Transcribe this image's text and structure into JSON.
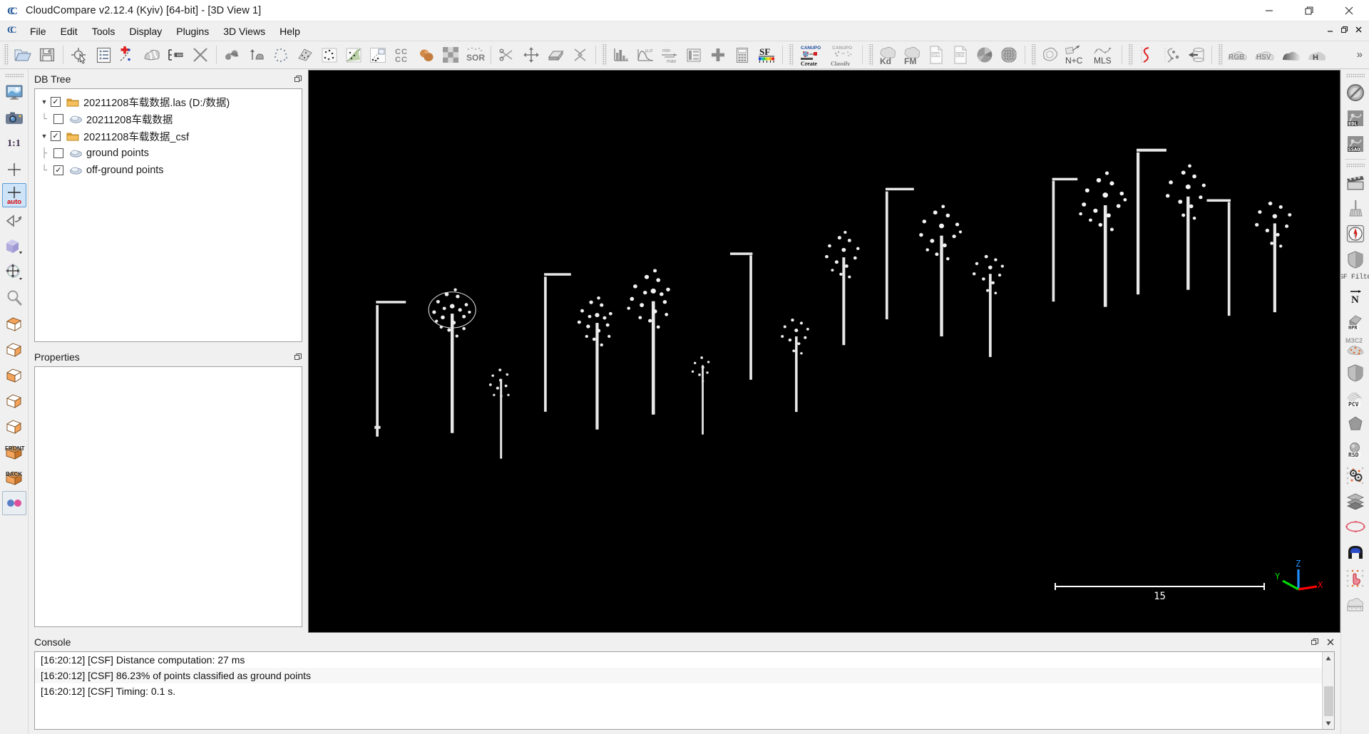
{
  "window": {
    "title": "CloudCompare v2.12.4 (Kyiv) [64-bit] - [3D View 1]",
    "app_icon": "C",
    "minimize": "—",
    "maximize": "❐",
    "close": "✕"
  },
  "menu": {
    "icon": "C",
    "items": [
      {
        "label": "File"
      },
      {
        "label": "Edit"
      },
      {
        "label": "Tools"
      },
      {
        "label": "Display"
      },
      {
        "label": "Plugins"
      },
      {
        "label": "3D Views"
      },
      {
        "label": "Help"
      }
    ],
    "mdi": {
      "minimize": "–",
      "restore": "❐",
      "close": "✕"
    }
  },
  "toolbar": {
    "overflow": "»",
    "groups": [
      {
        "buttons": [
          {
            "name": "open-file-icon",
            "label": ""
          },
          {
            "name": "save-file-icon",
            "label": ""
          }
        ]
      },
      {
        "buttons": [
          {
            "name": "select-entity-icon",
            "label": ""
          },
          {
            "name": "properties-list-icon",
            "label": ""
          },
          {
            "name": "add-point-pair-icon",
            "label": ""
          },
          {
            "name": "segment-cloud-icon",
            "label": ""
          },
          {
            "name": "translate-rotate-icon",
            "label": ""
          },
          {
            "name": "delete-icon",
            "label": ""
          }
        ]
      },
      {
        "buttons": [
          {
            "name": "clone-cloud-icon",
            "label": ""
          },
          {
            "name": "merge-clouds-icon",
            "label": ""
          },
          {
            "name": "subsample-icon",
            "label": ""
          },
          {
            "name": "fit-plane-icon",
            "label": ""
          },
          {
            "name": "registration-icon",
            "label": ""
          },
          {
            "name": "align-icon",
            "label": ""
          },
          {
            "name": "match-bbox-icon",
            "label": ""
          },
          {
            "name": "cloud-cloud-dist-icon",
            "label": "CC"
          },
          {
            "name": "cloud-mesh-dist-icon",
            "label": ""
          },
          {
            "name": "noise-filter-icon",
            "label": ""
          },
          {
            "name": "sor-filter-icon",
            "label": "SOR"
          }
        ]
      },
      {
        "buttons": [
          {
            "name": "scissors-cut-icon",
            "label": ""
          },
          {
            "name": "translate-axis-icon",
            "label": ""
          },
          {
            "name": "cross-section-icon",
            "label": ""
          },
          {
            "name": "unroll-icon",
            "label": ""
          }
        ]
      },
      {
        "buttons": [
          {
            "name": "histogram-icon",
            "label": ""
          },
          {
            "name": "gaussian-stats-icon",
            "label": "μ,σ"
          },
          {
            "name": "minmax-icon",
            "label": "min max"
          },
          {
            "name": "sf-gradient-icon",
            "label": ""
          },
          {
            "name": "sf-add-icon",
            "label": "+"
          },
          {
            "name": "sf-arithmetic-icon",
            "label": ""
          },
          {
            "name": "sf-colorscale-icon",
            "label": "SF"
          }
        ]
      },
      {
        "buttons": [
          {
            "name": "canupo-create-icon",
            "label": "CANUPO Create"
          },
          {
            "name": "canupo-classify-icon",
            "label": "CANUPO Classify"
          }
        ]
      },
      {
        "buttons": [
          {
            "name": "kdtree-icon",
            "label": "Kd"
          },
          {
            "name": "fastmarching-icon",
            "label": "FM"
          },
          {
            "name": "shp-export-icon",
            "label": "SHP"
          },
          {
            "name": "csv-export-icon",
            "label": "CSV"
          },
          {
            "name": "poisson-recon-icon",
            "label": ""
          },
          {
            "name": "qhull-sphere-icon",
            "label": ""
          }
        ]
      },
      {
        "buttons": [
          {
            "name": "contour-plugin-icon",
            "label": ""
          },
          {
            "name": "normal-curvature-icon",
            "label": "N+C"
          },
          {
            "name": "mls-smoothing-icon",
            "label": "MLS"
          }
        ]
      },
      {
        "buttons": [
          {
            "name": "spline-fit-icon",
            "label": ""
          },
          {
            "name": "ransac-shapes-icon",
            "label": ""
          },
          {
            "name": "cylinder-unroll-icon",
            "label": ""
          }
        ]
      },
      {
        "buttons": [
          {
            "name": "rgb-convert-icon",
            "label": "RGB"
          },
          {
            "name": "hsv-convert-icon",
            "label": "HSV"
          },
          {
            "name": "gradient-color-icon",
            "label": ""
          },
          {
            "name": "height-ramp-icon",
            "label": "H"
          }
        ]
      }
    ]
  },
  "left_toolbar": {
    "buttons": [
      {
        "name": "full-screen-view-icon",
        "label": "",
        "active": false
      },
      {
        "name": "snapshot-camera-icon",
        "label": "",
        "active": false
      },
      {
        "name": "zoom-one-to-one-icon",
        "label": "1:1",
        "active": false
      },
      {
        "name": "set-pivot-icon",
        "label": "+",
        "active": false
      },
      {
        "name": "auto-pivot-icon",
        "label": "auto",
        "active": true
      },
      {
        "name": "toggle-rotation-icon",
        "label": "",
        "active": false
      },
      {
        "name": "view-cube-dropdown-icon",
        "label": "",
        "active": false
      },
      {
        "name": "pivot-mode-dropdown-icon",
        "label": "",
        "active": false
      },
      {
        "name": "zoom-magnifier-icon",
        "label": "",
        "active": false
      },
      {
        "name": "view-top-icon",
        "label": "",
        "active": false
      },
      {
        "name": "view-bottom-icon",
        "label": "",
        "active": false
      },
      {
        "name": "view-left-icon",
        "label": "",
        "active": false
      },
      {
        "name": "view-right-icon",
        "label": "",
        "active": false
      },
      {
        "name": "view-front-cube-icon",
        "label": "",
        "active": false
      },
      {
        "name": "view-back-cube-icon",
        "label": "",
        "active": false
      },
      {
        "name": "view-front-label-icon",
        "label": "FRONT",
        "active": false
      },
      {
        "name": "view-back-label-icon",
        "label": "BACK",
        "active": false
      },
      {
        "name": "stereo-mode-icon",
        "label": "",
        "active": false
      }
    ]
  },
  "right_toolbar": {
    "groups": [
      {
        "buttons": [
          {
            "name": "no-shader-icon",
            "label": ""
          },
          {
            "name": "edl-shader-icon",
            "label": "EDL"
          },
          {
            "name": "ssao-shader-icon",
            "label": "SSAO"
          }
        ]
      },
      {
        "buttons": [
          {
            "name": "animation-plugin-icon",
            "label": ""
          },
          {
            "name": "broom-cleaner-icon",
            "label": ""
          },
          {
            "name": "compass-plugin-icon",
            "label": ""
          },
          {
            "name": "facets-plugin-icon",
            "label": ""
          },
          {
            "name": "csf-filter-icon",
            "label": "CSF Filter"
          },
          {
            "name": "normal-vector-icon",
            "label": "N"
          },
          {
            "name": "hpr-plugin-icon",
            "label": "HPR"
          },
          {
            "name": "m3c2-plugin-icon",
            "label": "M3C2"
          },
          {
            "name": "pcv-shield-icon",
            "label": ""
          },
          {
            "name": "pcv-plugin-icon",
            "label": "PCV"
          },
          {
            "name": "poisson-plugin-icon",
            "label": ""
          },
          {
            "name": "rsd-plugin-icon",
            "label": "RSD"
          },
          {
            "name": "sra-plugin-icon",
            "label": ""
          },
          {
            "name": "layers-plugin-icon",
            "label": ""
          },
          {
            "name": "ellipse-fit-icon",
            "label": ""
          },
          {
            "name": "tunnel-section-icon",
            "label": ""
          },
          {
            "name": "manual-pick-icon",
            "label": ""
          },
          {
            "name": "cloud-measure-icon",
            "label": ""
          }
        ]
      }
    ]
  },
  "db_tree": {
    "title": "DB Tree",
    "float_icon": "❐",
    "items": [
      {
        "label": "20211208车载数据.las (D:/数据)",
        "icon": "folder-icon",
        "checked": true,
        "expanded": true,
        "depth": 0,
        "name": "tree-item-las-file"
      },
      {
        "label": "20211208车载数据",
        "icon": "cloud-icon",
        "checked": false,
        "expanded": null,
        "depth": 1,
        "name": "tree-item-cloud"
      },
      {
        "label": "20211208车载数据_csf",
        "icon": "folder-icon",
        "checked": true,
        "expanded": true,
        "depth": 0,
        "name": "tree-item-csf-group"
      },
      {
        "label": "ground points",
        "icon": "cloud-icon",
        "checked": false,
        "expanded": null,
        "depth": 1,
        "name": "tree-item-ground-points"
      },
      {
        "label": "off-ground points",
        "icon": "cloud-icon",
        "checked": true,
        "expanded": null,
        "depth": 1,
        "name": "tree-item-off-ground-points"
      }
    ],
    "check_glyph": "✓"
  },
  "properties": {
    "title": "Properties",
    "float_icon": "❐"
  },
  "view3d": {
    "scale_label": "15",
    "axis": {
      "x": "X",
      "y": "Y",
      "z": "Z"
    },
    "colors": {
      "x": "#ff0000",
      "y": "#00dd00",
      "z": "#1e90ff",
      "background": "#000000"
    }
  },
  "console": {
    "title": "Console",
    "float_icon": "❐",
    "close_icon": "✕",
    "scroll_up": "▲",
    "scroll_down": "▼",
    "lines": [
      "[16:20:12] [CSF] Distance computation: 27 ms",
      "[16:20:12] [CSF] 86.23% of points classified as ground points",
      "[16:20:12] [CSF] Timing: 0.1 s."
    ]
  }
}
